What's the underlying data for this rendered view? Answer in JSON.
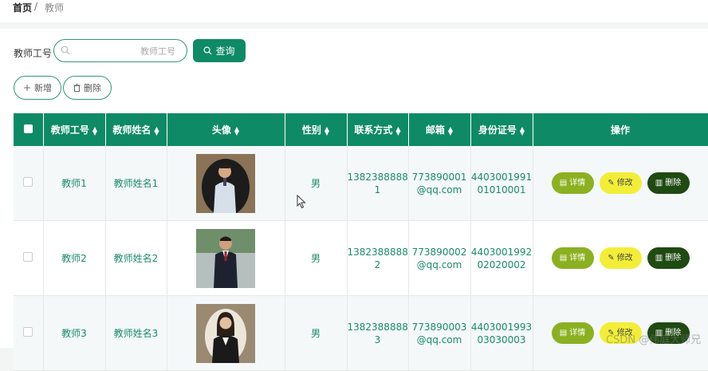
{
  "breadcrumb": {
    "home": "首页",
    "separator": "/",
    "current": "教师"
  },
  "search": {
    "label": "教师工号",
    "placeholder": "教师工号",
    "query_label": "查询"
  },
  "actions": {
    "add_label": "新增",
    "delete_label": "删除"
  },
  "table": {
    "headers": {
      "col_id": "教师工号",
      "col_name": "教师姓名",
      "col_avatar": "头像",
      "col_gender": "性别",
      "col_phone": "联系方式",
      "col_email": "邮箱",
      "col_idcard": "身份证号",
      "col_ops": "操作"
    },
    "rows": [
      {
        "id": "教师1",
        "name": "教师姓名1",
        "gender": "男",
        "phone": "1382388888 1",
        "email": "773890001 @qq.com",
        "idcard": "4403001991 01010001",
        "avatar": "portrait-man-white-shirt"
      },
      {
        "id": "教师2",
        "name": "教师姓名2",
        "gender": "男",
        "phone": "1382388888 2",
        "email": "773890002 @qq.com",
        "idcard": "4403001992 02020002",
        "avatar": "portrait-man-dark-suit"
      },
      {
        "id": "教师3",
        "name": "教师姓名3",
        "gender": "男",
        "phone": "1382388888 3",
        "email": "773890003 @qq.com",
        "idcard": "4403001993 03030003",
        "avatar": "portrait-woman-dark-jacket"
      }
    ],
    "ops": {
      "detail": "详情",
      "edit": "修改",
      "delete": "删除"
    }
  },
  "watermark": "CSDN @伟庭大师兄",
  "colors": {
    "primary": "#0e8a66",
    "detail": "#8bb020",
    "edit": "#f2ee38",
    "remove": "#1f4a12",
    "cell_text": "#1a8a6a"
  }
}
